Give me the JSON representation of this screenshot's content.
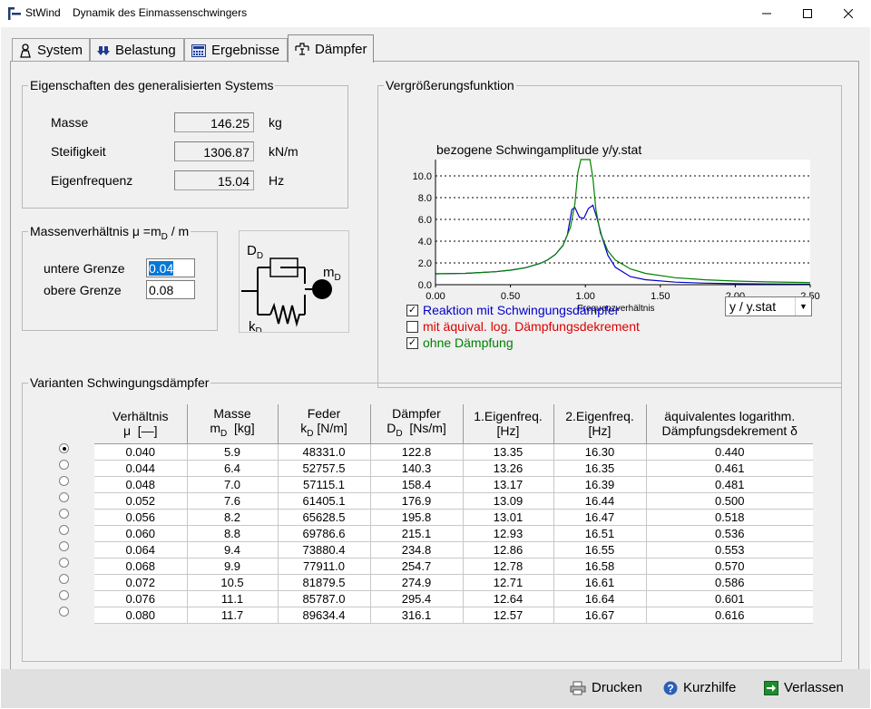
{
  "window": {
    "app_name": "StWind",
    "title": "Dynamik des Einmassenschwingers"
  },
  "tabs": [
    {
      "label": "System",
      "icon": "person-icon"
    },
    {
      "label": "Belastung",
      "icon": "double-arrow-down-icon"
    },
    {
      "label": "Ergebnisse",
      "icon": "calculator-icon"
    },
    {
      "label": "Dämpfer",
      "icon": "damper-icon",
      "active": true
    }
  ],
  "properties": {
    "title": "Eigenschaften des generalisierten Systems",
    "rows": [
      {
        "label": "Masse",
        "value": "146.25",
        "unit": "kg"
      },
      {
        "label": "Steifigkeit",
        "value": "1306.87",
        "unit": "kN/m"
      },
      {
        "label": "Eigenfrequenz",
        "value": "15.04",
        "unit": "Hz"
      }
    ]
  },
  "mass_ratio": {
    "title_prefix": "Massenverhältnis  μ =m",
    "title_sub": "D",
    "title_suffix": " / m",
    "lower_label": "untere Grenze",
    "lower_value": "0.04",
    "upper_label": "obere Grenze",
    "upper_value": "0.08"
  },
  "diagram": {
    "damper_label": "D",
    "damper_sub": "D",
    "spring_label": "k",
    "spring_sub": "D",
    "mass_label": "m",
    "mass_sub": "D"
  },
  "amplification": {
    "group_title": "Vergrößerungsfunktion",
    "checkboxes": [
      {
        "label": "Reaktion mit Schwingungsdämpfer",
        "checked": true,
        "color": "#0000cc"
      },
      {
        "label": "mit äquival. log. Dämpfungsdekrement",
        "checked": false,
        "color": "#dd0000"
      },
      {
        "label": "ohne Dämpfung",
        "checked": true,
        "color": "#008000"
      }
    ],
    "dropdown_value": "y / y.stat"
  },
  "chart_data": {
    "type": "line",
    "title": "bezogene Schwingamplitude y/y.stat",
    "xlabel": "Frequenzverhältnis",
    "ylabel": "",
    "xlim": [
      0,
      2.5
    ],
    "ylim": [
      0,
      11.5
    ],
    "xticks": [
      "0.00",
      "0.50",
      "1.00",
      "1.50",
      "2.00",
      "2.50"
    ],
    "yticks": [
      "0.0",
      "2.0",
      "4.0",
      "6.0",
      "8.0",
      "10.0"
    ],
    "grid": "horizontal-dotted",
    "series": [
      {
        "name": "Reaktion mit Schwingungsdämpfer",
        "color": "#0000cc",
        "x": [
          0,
          0.2,
          0.4,
          0.5,
          0.6,
          0.7,
          0.75,
          0.8,
          0.85,
          0.88,
          0.91,
          0.93,
          0.96,
          0.99,
          1.02,
          1.05,
          1.08,
          1.11,
          1.15,
          1.2,
          1.3,
          1.4,
          1.6,
          1.8,
          2.0,
          2.2,
          2.5
        ],
        "y": [
          1.0,
          1.04,
          1.19,
          1.33,
          1.56,
          1.96,
          2.29,
          2.78,
          3.6,
          4.6,
          6.9,
          7.1,
          6.2,
          6.1,
          7.0,
          7.3,
          6.0,
          4.4,
          2.7,
          1.6,
          0.74,
          0.46,
          0.23,
          0.14,
          0.09,
          0.07,
          0.04
        ]
      },
      {
        "name": "ohne Dämpfung",
        "color": "#008000",
        "x": [
          0,
          0.2,
          0.4,
          0.5,
          0.6,
          0.7,
          0.75,
          0.8,
          0.85,
          0.9,
          0.93,
          0.95,
          0.97,
          0.985,
          1.015,
          1.03,
          1.05,
          1.07,
          1.1,
          1.15,
          1.2,
          1.3,
          1.4,
          1.6,
          1.8,
          2.0,
          2.2,
          2.5
        ],
        "y": [
          1.0,
          1.04,
          1.19,
          1.33,
          1.56,
          1.96,
          2.29,
          2.78,
          3.6,
          5.26,
          7.4,
          10.3,
          11.5,
          11.5,
          11.5,
          11.5,
          9.8,
          6.9,
          4.76,
          3.1,
          2.27,
          1.45,
          1.04,
          0.64,
          0.45,
          0.33,
          0.26,
          0.19
        ]
      }
    ]
  },
  "variants": {
    "group_title": "Varianten Schwingungsdämpfer",
    "headers": [
      {
        "line1": "Verhältnis",
        "line2": "μ  [—]"
      },
      {
        "line1": "Masse",
        "line2": "m_D  [kg]"
      },
      {
        "line1": "Feder",
        "line2": "k_D  [N/m]"
      },
      {
        "line1": "Dämpfer",
        "line2": "D_D  [Ns/m]"
      },
      {
        "line1": "1.Eigenfreq.",
        "line2": "[Hz]"
      },
      {
        "line1": "2.Eigenfreq.",
        "line2": "[Hz]"
      },
      {
        "line1": "äquivalentes logarithm.",
        "line2": "Dämpfungsdekrement  δ"
      }
    ],
    "selected_index": 0,
    "rows": [
      [
        "0.040",
        "5.9",
        "48331.0",
        "122.8",
        "13.35",
        "16.30",
        "0.440"
      ],
      [
        "0.044",
        "6.4",
        "52757.5",
        "140.3",
        "13.26",
        "16.35",
        "0.461"
      ],
      [
        "0.048",
        "7.0",
        "57115.1",
        "158.4",
        "13.17",
        "16.39",
        "0.481"
      ],
      [
        "0.052",
        "7.6",
        "61405.1",
        "176.9",
        "13.09",
        "16.44",
        "0.500"
      ],
      [
        "0.056",
        "8.2",
        "65628.5",
        "195.8",
        "13.01",
        "16.47",
        "0.518"
      ],
      [
        "0.060",
        "8.8",
        "69786.6",
        "215.1",
        "12.93",
        "16.51",
        "0.536"
      ],
      [
        "0.064",
        "9.4",
        "73880.4",
        "234.8",
        "12.86",
        "16.55",
        "0.553"
      ],
      [
        "0.068",
        "9.9",
        "77911.0",
        "254.7",
        "12.78",
        "16.58",
        "0.570"
      ],
      [
        "0.072",
        "10.5",
        "81879.5",
        "274.9",
        "12.71",
        "16.61",
        "0.586"
      ],
      [
        "0.076",
        "11.1",
        "85787.0",
        "295.4",
        "12.64",
        "16.64",
        "0.601"
      ],
      [
        "0.080",
        "11.7",
        "89634.4",
        "316.1",
        "12.57",
        "16.67",
        "0.616"
      ]
    ]
  },
  "footer": {
    "print_label": "Drucken",
    "help_label": "Kurzhilfe",
    "exit_label": "Verlassen"
  }
}
